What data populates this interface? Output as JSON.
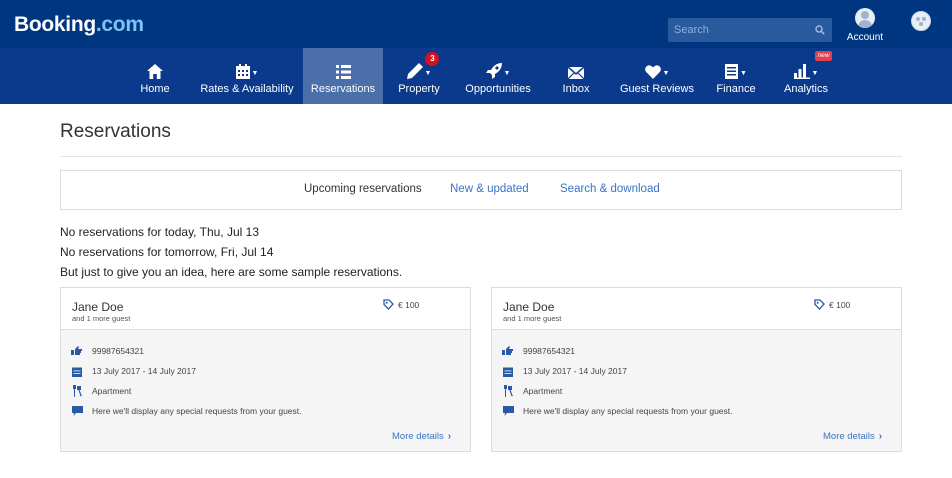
{
  "header": {
    "logo_main": "Booking",
    "logo_suffix": ".com",
    "search_placeholder": "Search",
    "account_label": "Account"
  },
  "nav": [
    {
      "label": "Home",
      "icon": "home-icon"
    },
    {
      "label": "Rates & Availability",
      "icon": "calendar-icon"
    },
    {
      "label": "Reservations",
      "icon": "list-icon",
      "active": true
    },
    {
      "label": "Property",
      "icon": "pen-icon",
      "badge": "3"
    },
    {
      "label": "Opportunities",
      "icon": "rocket-icon"
    },
    {
      "label": "Inbox",
      "icon": "envelope-icon"
    },
    {
      "label": "Guest Reviews",
      "icon": "heart-icon"
    },
    {
      "label": "Finance",
      "icon": "document-icon"
    },
    {
      "label": "Analytics",
      "icon": "bar-chart-icon",
      "badge": "new"
    }
  ],
  "page": {
    "title": "Reservations"
  },
  "tabs": [
    {
      "label": "Upcoming reservations",
      "active": true
    },
    {
      "label": "New & updated"
    },
    {
      "label": "Search & download"
    }
  ],
  "messages": [
    "No reservations for today, Thu, Jul 13",
    "No reservations for tomorrow, Fri, Jul 14",
    "But just to give you an idea, here are some sample reservations."
  ],
  "reservations": [
    {
      "guest": "Jane Doe",
      "extra_guests": "and 1 more guest",
      "price": "€ 100",
      "reference": "99987654321",
      "dates": "13 July 2017 - 14 July 2017",
      "room": "Apartment",
      "requests": "Here we'll display any special requests from your guest.",
      "more_details": "More details"
    },
    {
      "guest": "Jane Doe",
      "extra_guests": "and 1 more guest",
      "price": "€ 100",
      "reference": "99987654321",
      "dates": "13 July 2017 - 14 July 2017",
      "room": "Apartment",
      "requests": "Here we'll display any special requests from your guest.",
      "more_details": "More details"
    }
  ],
  "colors": {
    "topbar": "#003580",
    "navbar": "#0b3a8c",
    "nav_active": "#4b6fa8",
    "link": "#3a74c4",
    "icon_blue": "#2a5aa6"
  }
}
